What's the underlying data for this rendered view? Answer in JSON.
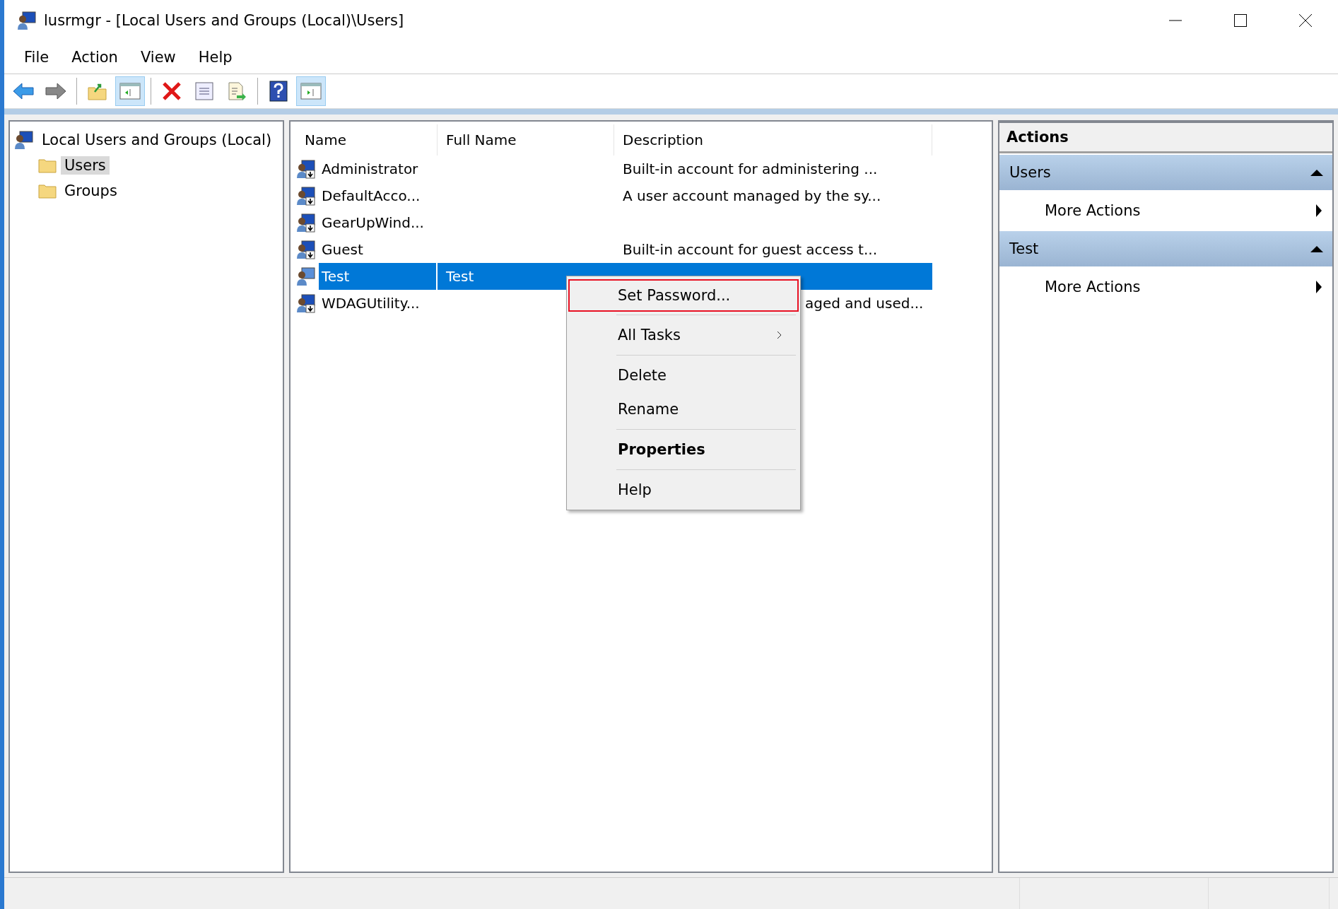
{
  "window": {
    "title": "lusrmgr - [Local Users and Groups (Local)\\Users]"
  },
  "menu_bar": [
    "File",
    "Action",
    "View",
    "Help"
  ],
  "toolbar": [
    {
      "buttons": [
        {
          "kind": "back",
          "pressed": false
        },
        {
          "kind": "forward",
          "pressed": false
        }
      ]
    },
    {
      "buttons": [
        {
          "kind": "up",
          "pressed": false
        },
        {
          "kind": "tree",
          "pressed": true
        }
      ]
    },
    {
      "buttons": [
        {
          "kind": "delete",
          "pressed": false
        },
        {
          "kind": "properties",
          "pressed": false
        },
        {
          "kind": "export",
          "pressed": false
        }
      ]
    },
    {
      "buttons": [
        {
          "kind": "help",
          "pressed": false
        },
        {
          "kind": "action_pane",
          "pressed": true
        }
      ]
    }
  ],
  "tree": [
    {
      "label": "Local Users and Groups (Local)",
      "kind": "computer",
      "selected": false,
      "children": [
        {
          "label": "Users",
          "kind": "folder",
          "selected": true
        },
        {
          "label": "Groups",
          "kind": "folder",
          "selected": false
        }
      ]
    }
  ],
  "table": {
    "columns": [
      "Name",
      "Full Name",
      "Description"
    ],
    "rows": [
      {
        "name": "Administrator",
        "description": "Built-in account for administering ...",
        "selected": false
      },
      {
        "name": "DefaultAcco...",
        "description": "A user account managed by the sy...",
        "selected": false
      },
      {
        "name": "GearUpWind...",
        "selected": false
      },
      {
        "name": "Guest",
        "description": "Built-in account for guest access t...",
        "selected": false
      },
      {
        "name": "Test",
        "full_name": "Test",
        "selected": true
      },
      {
        "name": "WDAGUtility...",
        "description": "aged and used...",
        "selected": false
      }
    ]
  },
  "context_menu": [
    {
      "kind": "item",
      "label": "Set Password...",
      "highlighted": true,
      "default": false,
      "has_submenu": false
    },
    {
      "kind": "separator"
    },
    {
      "kind": "item",
      "label": "All Tasks",
      "highlighted": false,
      "default": false,
      "has_submenu": true
    },
    {
      "kind": "separator"
    },
    {
      "kind": "item",
      "label": "Delete",
      "highlighted": false,
      "default": false,
      "has_submenu": false
    },
    {
      "kind": "item",
      "label": "Rename",
      "highlighted": false,
      "default": false,
      "has_submenu": false
    },
    {
      "kind": "separator"
    },
    {
      "kind": "item",
      "label": "Properties",
      "highlighted": false,
      "default": true,
      "has_submenu": false
    },
    {
      "kind": "separator"
    },
    {
      "kind": "item",
      "label": "Help",
      "highlighted": false,
      "default": false,
      "has_submenu": false
    }
  ],
  "actions": {
    "title": "Actions",
    "sections": [
      {
        "title": "Users",
        "expanded": true,
        "items": [
          {
            "label": "More Actions",
            "has_submenu": true
          }
        ]
      },
      {
        "title": "Test",
        "expanded": true,
        "items": [
          {
            "label": "More Actions",
            "has_submenu": true
          }
        ]
      }
    ]
  }
}
